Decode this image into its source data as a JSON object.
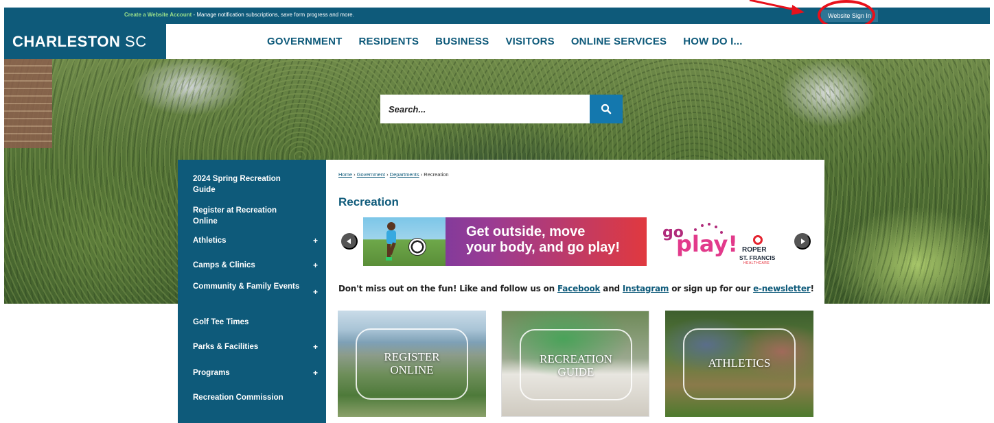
{
  "topbar": {
    "create_account_link": "Create a Website Account",
    "create_account_desc": " - Manage notification subscriptions, save form progress and more.",
    "sign_in_label": "Website Sign In"
  },
  "header": {
    "logo_main": "CHARLESTON",
    "logo_suffix": "SC",
    "nav": [
      "GOVERNMENT",
      "RESIDENTS",
      "BUSINESS",
      "VISITORS",
      "ONLINE SERVICES",
      "HOW DO I..."
    ]
  },
  "search": {
    "placeholder": "Search..."
  },
  "sidebar": {
    "items": [
      {
        "label": "2024 Spring Recreation Guide",
        "expandable": false
      },
      {
        "label": "Register at Recreation Online",
        "expandable": false
      },
      {
        "label": "Athletics",
        "expandable": true
      },
      {
        "label": "Camps & Clinics",
        "expandable": true
      },
      {
        "label": "Community & Family Events",
        "expandable": true
      },
      {
        "label": "Golf Tee Times",
        "expandable": false
      },
      {
        "label": "Parks & Facilities",
        "expandable": true
      },
      {
        "label": "Programs",
        "expandable": true
      },
      {
        "label": "Recreation Commission",
        "expandable": false
      }
    ],
    "plus_glyph": "+"
  },
  "breadcrumb": {
    "items": [
      "Home",
      "Government",
      "Departments"
    ],
    "current": "Recreation",
    "separator": "›"
  },
  "page_title": "Recreation",
  "banner": {
    "line1": "Get outside, move",
    "line2": "your body, and go play!",
    "brand_go": "go",
    "brand_play": "play!",
    "sponsor_line1": "ROPER",
    "sponsor_line2": "ST. FRANCIS",
    "sponsor_line3": "HEALTHCARE"
  },
  "social": {
    "before": "Don't miss out on the fun! Like and follow us on ",
    "facebook": "Facebook",
    "and": " and ",
    "instagram": "Instagram",
    "middle": " or sign up for our ",
    "newsletter": "e-newsletter",
    "end": "!"
  },
  "tiles": [
    {
      "line1": "REGISTER",
      "line2": "ONLINE"
    },
    {
      "line1": "RECREATION",
      "line2": "GUIDE"
    },
    {
      "line1": "ATHLETICS",
      "line2": ""
    }
  ],
  "colors": {
    "brand": "#0e5a7a",
    "search_button": "#1478ae",
    "annotation": "#e8111b"
  }
}
